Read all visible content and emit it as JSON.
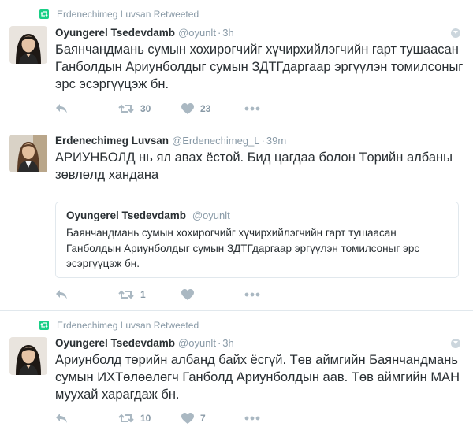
{
  "tweets": [
    {
      "retweeted_by": "Erdenechimeg Luvsan Retweeted",
      "name": "Oyungerel Tsedevdamb",
      "handle": "@oyunlt",
      "separator": "·",
      "time": "3h",
      "text": "Баянчандмань сумын хохирогчийг хүчирхийлэгчийн гарт тушаасан Ганболдын Ариунболдыг сумын ЗДТГдаргаар эргүүлэн томилсоныг эрс эсэргүүцэж бн.",
      "retweets": "30",
      "likes": "23"
    },
    {
      "name": "Erdenechimeg Luvsan",
      "handle": "@Erdenechimeg_L",
      "separator": "·",
      "time": "39m",
      "text": "АРИУНБОЛД нь ял авах ёстой. Бид цагдаа болон Төрийн албаны зөвлөлд хандана",
      "quoted": {
        "name": "Oyungerel Tsedevdamb",
        "handle": "@oyunlt",
        "text": "Баянчандмань сумын хохирогчийг хүчирхийлэгчийн гарт тушаасан Ганболдын Ариунболдыг сумын ЗДТГдаргаар эргүүлэн томилсоныг эрс эсэргүүцэж бн."
      },
      "retweets": "1",
      "likes": ""
    },
    {
      "retweeted_by": "Erdenechimeg Luvsan Retweeted",
      "name": "Oyungerel Tsedevdamb",
      "handle": "@oyunlt",
      "separator": "·",
      "time": "3h",
      "text": "Ариунболд төрийн албанд байх ёсгүй. Төв аймгийн Баянчандмань сумын ИХТөлөөлөгч Ганболд Ариунболдын аав. Төв аймгийн МАН муухай харагдаж бн.",
      "retweets": "10",
      "likes": "7"
    }
  ],
  "icons": {
    "reply": "reply-icon",
    "retweet": "retweet-icon",
    "like": "heart-icon",
    "more": "more-icon",
    "retweeted": "retweeted-icon",
    "caret": "caret-down-icon"
  },
  "colors": {
    "retweet_green": "#19cf86",
    "muted": "#8899a6",
    "action_grey": "#aab8c2",
    "border": "#e1e8ed"
  }
}
